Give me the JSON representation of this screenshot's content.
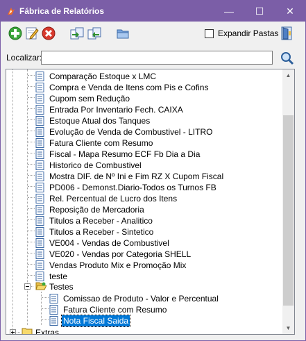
{
  "window": {
    "title": "Fábrica de Relatórios",
    "controls": {
      "minimize": "—",
      "maximize": "☐",
      "close": "✕"
    },
    "title_bar_color": "#7b5ea7"
  },
  "toolbar": {
    "buttons": [
      {
        "name": "add-button",
        "icon": "plus-icon"
      },
      {
        "name": "edit-button",
        "icon": "pencil-icon"
      },
      {
        "name": "delete-button",
        "icon": "x-icon"
      },
      {
        "name": "import-button",
        "icon": "import-icon"
      },
      {
        "name": "export-button",
        "icon": "export-icon"
      },
      {
        "name": "open-folder-button",
        "icon": "folder-icon"
      },
      {
        "name": "exit-button",
        "icon": "exit-door-icon"
      }
    ],
    "expand_folders_label": "Expandir Pastas",
    "expand_folders_checked": false
  },
  "search": {
    "label": "Localizar:",
    "value": "",
    "button_icon": "magnifier-icon"
  },
  "tree": {
    "items": [
      {
        "label": "Comparação Estoque x LMC"
      },
      {
        "label": "Compra e Venda  de Itens com Pis e Cofins"
      },
      {
        "label": "Cupom sem Redução"
      },
      {
        "label": "Entrada Por Inventario Fech. CAIXA"
      },
      {
        "label": "Estoque Atual dos Tanques"
      },
      {
        "label": "Evolução de Venda de Combustivel - LITRO"
      },
      {
        "label": "Fatura Cliente com Resumo"
      },
      {
        "label": "Fiscal - Mapa Resumo ECF Fb Dia a Dia"
      },
      {
        "label": "Historico de Combustivel"
      },
      {
        "label": "Mostra DIF. de Nº Ini e Fim RZ X Cupom Fiscal"
      },
      {
        "label": "PD006 - Demonst.Diario-Todos os Turnos FB"
      },
      {
        "label": "Rel. Percentual de Lucro dos Itens"
      },
      {
        "label": "Reposição de Mercadoria"
      },
      {
        "label": "Titulos a Receber - Analitico"
      },
      {
        "label": "Titulos a Receber - Sintetico"
      },
      {
        "label": "VE004 - Vendas de Combustivel"
      },
      {
        "label": "VE020 - Vendas por Categoria SHELL"
      },
      {
        "label": "Vendas Produto Mix e Promoção Mix"
      },
      {
        "label": "teste"
      }
    ],
    "folder_testes": {
      "label": "Testes",
      "expanded": true,
      "children": [
        {
          "label": "Comissao de Produto - Valor e Percentual"
        },
        {
          "label": "Fatura Cliente com Resumo"
        },
        {
          "label": "Nota Fiscal Saida",
          "selected": true
        }
      ]
    },
    "folder_extras": {
      "label": "Extras",
      "expanded": false
    }
  }
}
